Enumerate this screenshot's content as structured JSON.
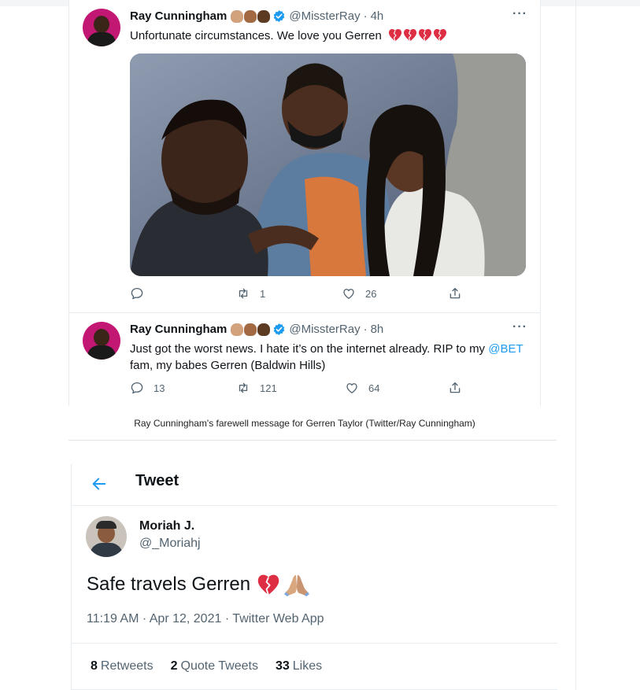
{
  "embed": {
    "tweets": [
      {
        "name": "Ray Cunningham",
        "handle": "@MissterRay",
        "time": "4h",
        "text": "Unfortunate circumstances. We love you Gerren",
        "counts": {
          "reply": "",
          "retweet": "1",
          "like": "26"
        }
      },
      {
        "name": "Ray Cunningham",
        "handle": "@MissterRay",
        "time": "8h",
        "text_line1": "Just got the worst news. I hate it’s on the internet already. RIP to my",
        "mention": "@BET",
        "text_line2": "fam, my babes Gerren (Baldwin Hills)",
        "counts": {
          "reply": "13",
          "retweet": "121",
          "like": "64"
        }
      }
    ],
    "caption": "Ray Cunningham's farewell message for Gerren Taylor (Twitter/Ray Cunningham)"
  },
  "detail": {
    "header_title": "Tweet",
    "author_name": "Moriah J.",
    "author_handle": "@_Moriahj",
    "text": "Safe travels Gerren",
    "meta": "11:19 AM · Apr 12, 2021 · Twitter Web App",
    "stats": [
      {
        "count": "8",
        "label": "Retweets"
      },
      {
        "count": "2",
        "label": "Quote Tweets"
      },
      {
        "count": "33",
        "label": "Likes"
      }
    ]
  },
  "colors": {
    "accent": "#1d9bf0",
    "muted": "#536471",
    "heart_red": "#e0245e",
    "avatar_magenta": "#c21874"
  },
  "icons": [
    "more-icon",
    "verified-icon",
    "reply-icon",
    "retweet-icon",
    "like-icon",
    "share-icon",
    "back-arrow-icon",
    "broken-heart-icon",
    "folded-hands-icon",
    "fist-icon"
  ]
}
